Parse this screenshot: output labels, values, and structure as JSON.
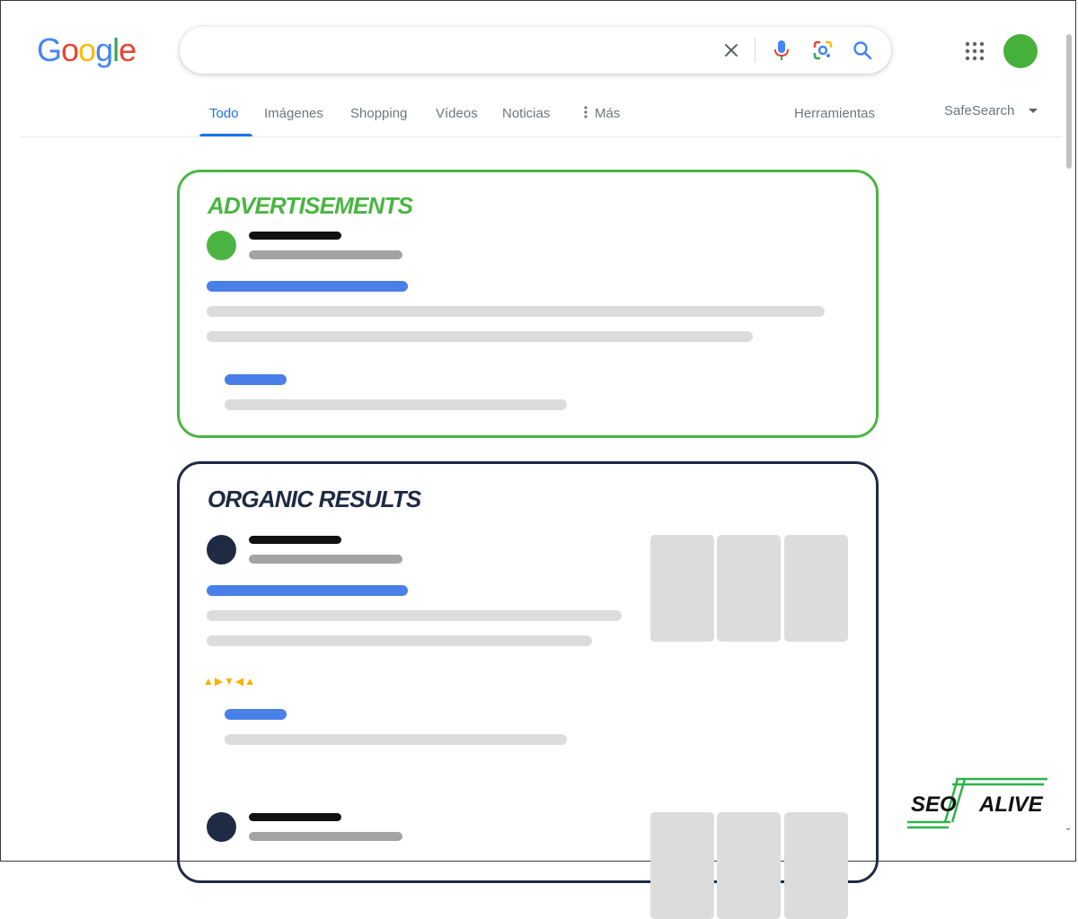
{
  "logo": {
    "letters": [
      "G",
      "o",
      "o",
      "g",
      "l",
      "e"
    ],
    "colors": [
      "#4285F4",
      "#EA4335",
      "#FBBC05",
      "#4285F4",
      "#34A853",
      "#EA4335"
    ]
  },
  "search": {
    "value": "",
    "placeholder": "",
    "icons": [
      "close-icon",
      "microphone-icon",
      "google-lens-icon",
      "search-icon"
    ]
  },
  "header": {
    "apps_icon": "apps-grid-icon",
    "avatar_color": "#47b03a"
  },
  "tabs": [
    {
      "label": "Todo",
      "active": true
    },
    {
      "label": "Imágenes"
    },
    {
      "label": "Shopping"
    },
    {
      "label": "Vídeos"
    },
    {
      "label": "Noticias"
    },
    {
      "label": "Más"
    }
  ],
  "tools": {
    "herramientas": "Herramientas",
    "safesearch": "SafeSearch"
  },
  "colors": {
    "ad_green": "#4bb543",
    "organic_navy": "#1f2a44",
    "link_blue": "#4a7fe8",
    "title_black": "#111111",
    "meta_gray": "#a3a3a3",
    "snippet_gray": "#dcdcdc",
    "star_yellow": "#f4b400"
  },
  "ads_box": {
    "title": "ADVERTISEMENTS"
  },
  "organic_box": {
    "title": "ORGANIC RESULTS",
    "rating_glyphs": "▲▶▼◀▲"
  },
  "watermark": {
    "left": "SEO",
    "right": "ALIVE"
  }
}
